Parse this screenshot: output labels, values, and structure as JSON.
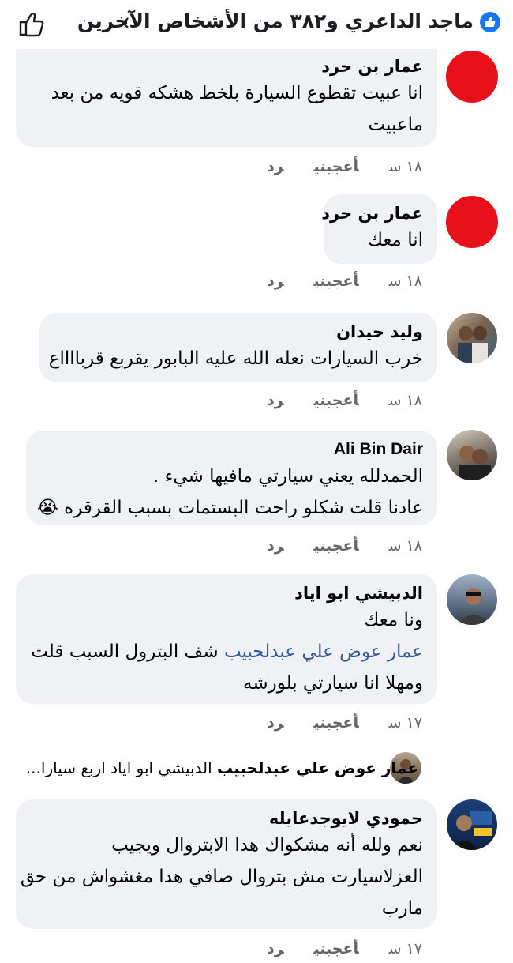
{
  "header": {
    "title": "ماجد الداعري و٣٨٢ من الأشخاص الآخرين"
  },
  "comments": [
    {
      "name": "عمار بن حرد",
      "lines": [
        "انا عبيت تقطوع السيارة بلخط  هشكه قويه من بعد",
        "ماعبيت"
      ],
      "time": "١٨ س",
      "like": "أعجبني",
      "reply": "رد"
    },
    {
      "name": "عمار بن حرد",
      "lines": [
        "انا معك"
      ],
      "time": "١٨ س",
      "like": "أعجبني",
      "reply": "رد"
    },
    {
      "name": "وليد حيدان",
      "lines": [
        "خرب السيارات نعله الله عليه البابور يقربع قربااااع"
      ],
      "time": "١٨ س",
      "like": "أعجبني",
      "reply": "رد"
    },
    {
      "name": "Ali Bin Dair",
      "lines": [
        "الحمدلله يعني سيارتي مافيها شيء .",
        "عادنا قلت شكلو  راحت البستمات بسبب القرقره 😭"
      ],
      "time": "١٨ س",
      "like": "أعجبني",
      "reply": "رد"
    },
    {
      "name": "الدبيشي ابو اياد",
      "line1": "ونا معك",
      "mention": "عمار عوض علي عبدلحبيب",
      "after_mention": " شف البترول السبب قلت",
      "line3": "ومهلا انا سيارتي بلورشه",
      "time": "١٧ س",
      "like": "أعجبني",
      "reply": "رد"
    },
    {
      "name": "حمودي لايوجدعايله",
      "lines": [
        "نعم ولله أنه مشكواك هدا الابتروال ويجيب",
        "العزلاسيارت مش بتروال صافي هدا مغشواش من حق",
        "مارب"
      ],
      "time": "١٧ س",
      "like": "أعجبني",
      "reply": "رد"
    }
  ],
  "reply_preview": {
    "author": "عمار عوض علي عبدلحبيب",
    "text": " الدبيشي ابو اياد اربع سيارا..."
  }
}
